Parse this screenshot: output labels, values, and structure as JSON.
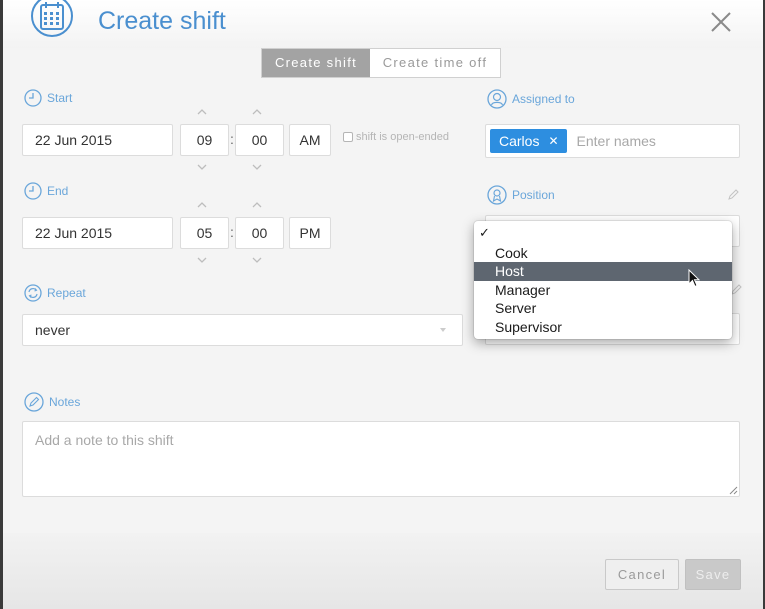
{
  "dialog": {
    "title": "Create shift",
    "close_icon": "close-icon",
    "header_icon": "calendar-icon"
  },
  "tabs": [
    {
      "label": "Create shift",
      "active": true
    },
    {
      "label": "Create time off",
      "active": false
    }
  ],
  "start": {
    "label": "Start",
    "icon": "clock-icon",
    "date": "22 Jun 2015",
    "hour": "09",
    "minute": "00",
    "ampm": "AM",
    "open_ended_label": "shift is open-ended",
    "open_ended_checked": false
  },
  "end": {
    "label": "End",
    "icon": "clock-icon",
    "date": "22 Jun 2015",
    "hour": "05",
    "minute": "00",
    "ampm": "PM"
  },
  "repeat": {
    "label": "Repeat",
    "icon": "repeat-icon",
    "value": "never"
  },
  "assigned": {
    "label": "Assigned to",
    "icon": "person-icon",
    "chips": [
      "Carlos"
    ],
    "placeholder": "Enter names"
  },
  "position": {
    "label": "Position",
    "icon": "badge-icon",
    "options": [
      "",
      "Cook",
      "Host",
      "Manager",
      "Server",
      "Supervisor"
    ],
    "checked_index": 0,
    "hover_index": 2
  },
  "notes": {
    "label": "Notes",
    "icon": "pencil-circle-icon",
    "placeholder": "Add a note to this shift"
  },
  "footer": {
    "cancel_label": "Cancel",
    "save_label": "Save"
  },
  "colors": {
    "accent": "#4a8fcf",
    "chip": "#2d8ee0",
    "tab_active": "#a3a3a3",
    "dropdown_hover": "#5e6670"
  }
}
